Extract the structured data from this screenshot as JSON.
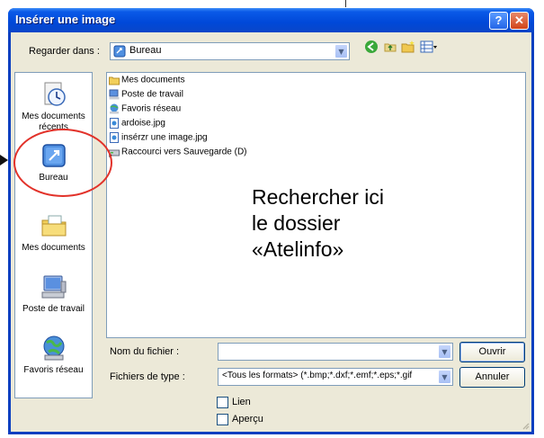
{
  "window": {
    "title": "Insérer une image"
  },
  "titlebar_buttons": {
    "help": "?",
    "close": "✕"
  },
  "look_in": {
    "label": "Regarder dans :",
    "value": "Bureau"
  },
  "places": [
    {
      "label": "Mes documents récents",
      "icon": "recent-documents-icon"
    },
    {
      "label": "Bureau",
      "icon": "desktop-icon"
    },
    {
      "label": "Mes documents",
      "icon": "my-documents-icon"
    },
    {
      "label": "Poste de travail",
      "icon": "my-computer-icon"
    },
    {
      "label": "Favoris réseau",
      "icon": "network-places-icon"
    }
  ],
  "files": [
    {
      "name": "Mes documents",
      "icon": "folder-icon"
    },
    {
      "name": "Poste de travail",
      "icon": "computer-icon"
    },
    {
      "name": "Favoris réseau",
      "icon": "network-icon"
    },
    {
      "name": "ardoise.jpg",
      "icon": "image-file-icon"
    },
    {
      "name": "insérzr une image.jpg",
      "icon": "image-file-icon"
    },
    {
      "name": "Raccourci vers Sauvegarde (D)",
      "icon": "drive-shortcut-icon"
    }
  ],
  "annotation": "Rechercher ici\nle dossier\n«Atelinfo»",
  "filename": {
    "label": "Nom du fichier :",
    "value": ""
  },
  "filetype": {
    "label": "Fichiers de type :",
    "value": "<Tous les formats> (*.bmp;*.dxf;*.emf;*.eps;*.gif"
  },
  "buttons": {
    "open": "Ouvrir",
    "cancel": "Annuler"
  },
  "checkboxes": {
    "link": "Lien",
    "preview": "Aperçu"
  },
  "colors": {
    "titlebar": "#0a5ae8",
    "highlight_circle": "#e2322a",
    "dialog_bg": "#ece9d8"
  }
}
